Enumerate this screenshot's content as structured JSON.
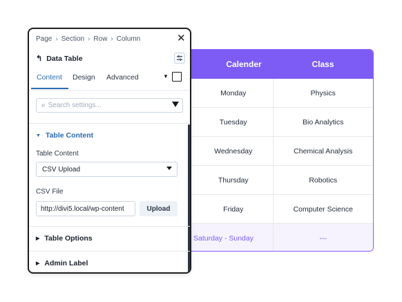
{
  "panel": {
    "breadcrumb": [
      "Page",
      "Section",
      "Row",
      "Column"
    ],
    "breadcrumb_sep": "›",
    "close_glyph": "✕",
    "back_glyph": "↰",
    "title": "Data Table",
    "tabs": [
      "Content",
      "Design",
      "Advanced"
    ],
    "active_tab": "Content",
    "search_placeholder": "Search settings...",
    "sections": {
      "table_content": {
        "heading": "Table Content",
        "fields": {
          "table_content": {
            "label": "Table Content",
            "value": "CSV Upload"
          },
          "csv_file": {
            "label": "CSV File",
            "value": "http://divi5.local/wp-content",
            "button": "Upload"
          }
        }
      },
      "table_options": {
        "heading": "Table Options"
      },
      "admin_label": {
        "heading": "Admin Label"
      }
    }
  },
  "table": {
    "headers": [
      "Calender",
      "Class"
    ],
    "rows": [
      [
        "Monday",
        "Physics"
      ],
      [
        "Tuesday",
        "Bio Analytics"
      ],
      [
        "Wednesday",
        "Chemical Analysis"
      ],
      [
        "Thursday",
        "Robotics"
      ],
      [
        "Friday",
        "Computer Science"
      ]
    ],
    "footer": [
      "Saturday - Sunday",
      "---"
    ]
  },
  "colors": {
    "accent_purple": "#7c5cf5",
    "active_blue": "#2b6cb0"
  }
}
